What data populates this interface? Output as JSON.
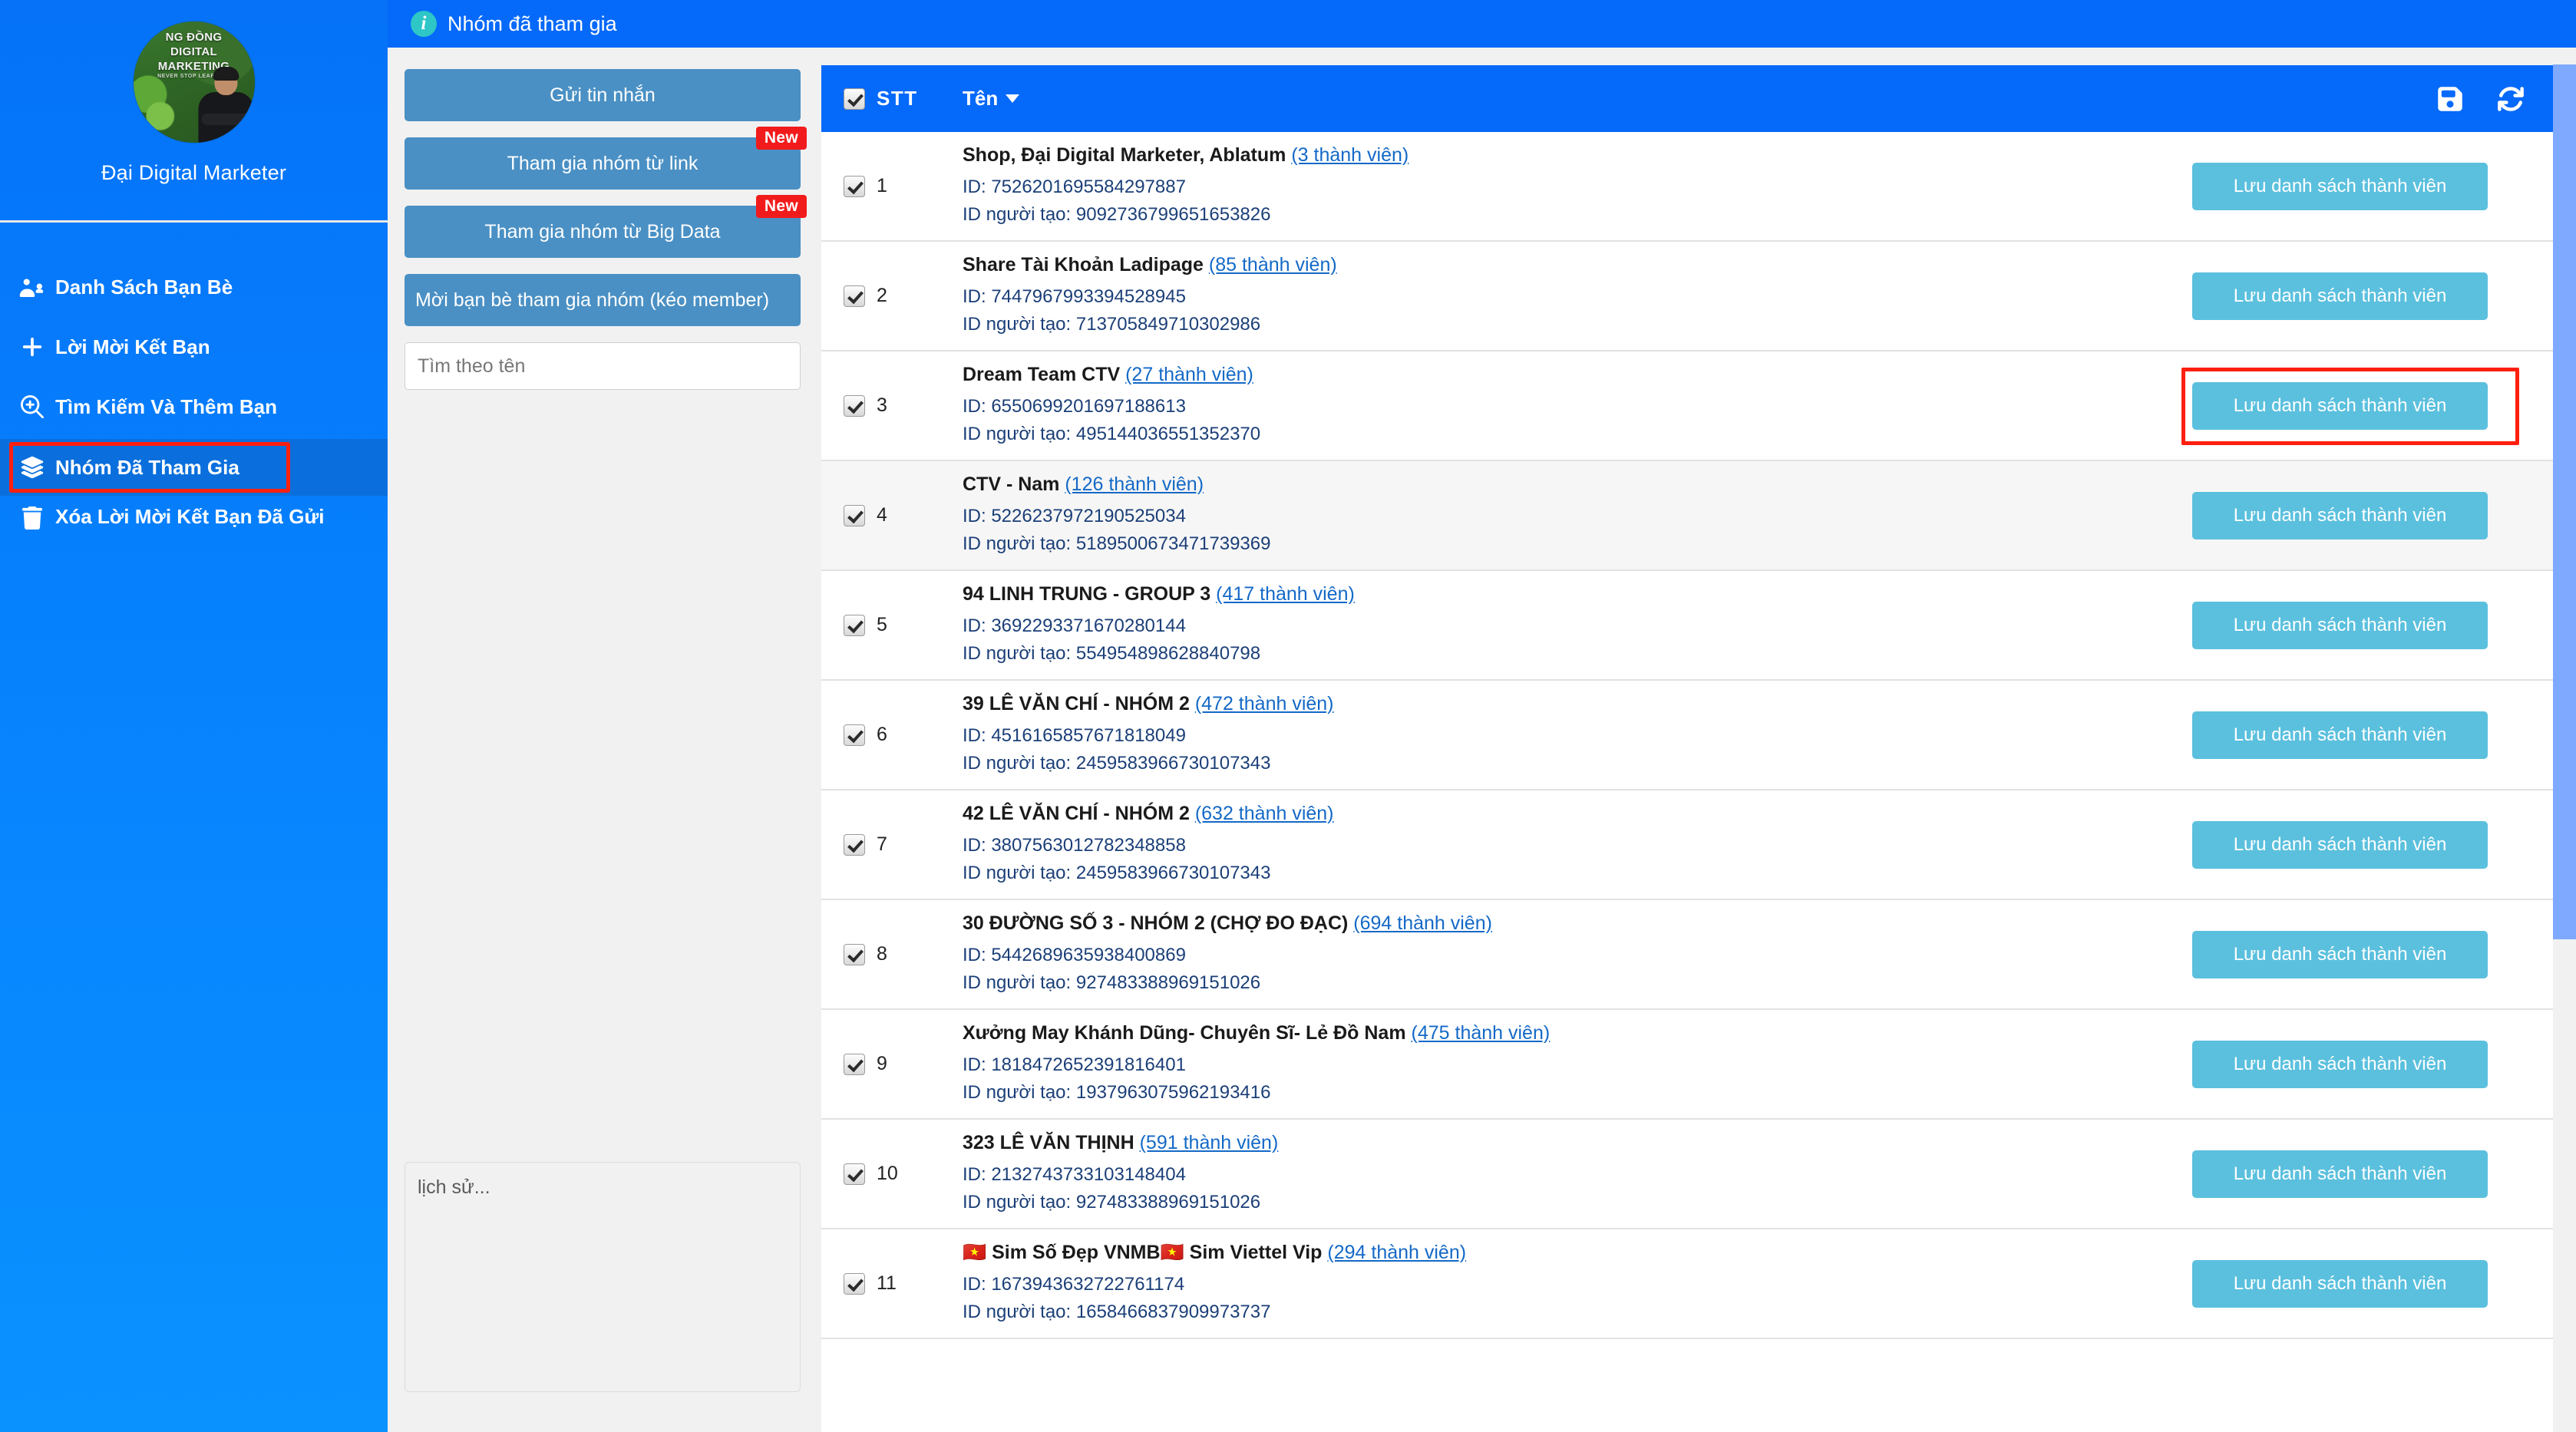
{
  "sidebar": {
    "profile": {
      "name": "Đại Digital Marketer",
      "avatar_line1": "NG ĐỒNG",
      "avatar_line2": "DIGITAL MARKETING",
      "avatar_line3": "NEVER STOP LEARNING"
    },
    "items": [
      {
        "label": "Danh Sách Bạn Bè",
        "icon": "users-icon",
        "active": false
      },
      {
        "label": "Lời Mời Kết Bạn",
        "icon": "plus-icon",
        "active": false
      },
      {
        "label": "Tìm Kiếm Và Thêm Bạn",
        "icon": "search-plus-icon",
        "active": false
      },
      {
        "label": "Nhóm Đã Tham Gia",
        "icon": "layers-icon",
        "active": true
      },
      {
        "label": "Xóa Lời Mời Kết Bạn Đã Gửi",
        "icon": "trash-icon",
        "active": false
      }
    ]
  },
  "topbar": {
    "title": "Nhóm đã tham gia",
    "icon": "info-icon"
  },
  "midpanel": {
    "buttons": [
      {
        "label": "Gửi tin nhắn",
        "badge": ""
      },
      {
        "label": "Tham gia nhóm từ link",
        "badge": "New"
      },
      {
        "label": "Tham gia nhóm từ Big Data",
        "badge": "New"
      },
      {
        "label": "Mời bạn bè tham gia nhóm (kéo member)",
        "badge": ""
      }
    ],
    "search_placeholder": "Tìm theo tên",
    "search_value": "",
    "history_placeholder": "lịch sử...",
    "history_value": ""
  },
  "table": {
    "header": {
      "stt": "STT",
      "ten": "Tên",
      "sort_icon": "chevron-down-icon",
      "save_icon": "floppy-disk-icon",
      "refresh_icon": "refresh-icon",
      "select_all_checked": true
    },
    "save_button_label": "Lưu danh sách thành viên",
    "id_label": "ID:",
    "creator_label": "ID người tạo:",
    "rows": [
      {
        "stt": "1",
        "name": "Shop, Đại Digital Marketer, Ablatum",
        "members": "(3 thành viên)",
        "id": "ID: 7526201695584297887",
        "creator": "ID người tạo: 9092736799651653826",
        "checked": true,
        "highlight": false,
        "flag_prefix": "",
        "flag_mid": ""
      },
      {
        "stt": "2",
        "name": "Share Tài Khoản Ladipage",
        "members": "(85 thành viên)",
        "id": "ID: 7447967993394528945",
        "creator": "ID người tạo: 713705849710302986",
        "checked": true,
        "highlight": false,
        "flag_prefix": "",
        "flag_mid": ""
      },
      {
        "stt": "3",
        "name": "Dream Team CTV",
        "members": "(27 thành viên)",
        "id": "ID: 6550699201697188613",
        "creator": "ID người tạo: 495144036551352370",
        "checked": true,
        "highlight": true,
        "flag_prefix": "",
        "flag_mid": ""
      },
      {
        "stt": "4",
        "name": "CTV - Nam",
        "members": "(126 thành viên)",
        "id": "ID: 5226237972190525034",
        "creator": "ID người tạo: 5189500673471739369",
        "checked": true,
        "highlight": false,
        "flag_prefix": "",
        "flag_mid": ""
      },
      {
        "stt": "5",
        "name": "94 LINH TRUNG - GROUP 3",
        "members": "(417 thành viên)",
        "id": "ID: 3692293371670280144",
        "creator": "ID người tạo: 554954898628840798",
        "checked": true,
        "highlight": false,
        "flag_prefix": "",
        "flag_mid": ""
      },
      {
        "stt": "6",
        "name": "39 LÊ VĂN CHÍ - NHÓM 2",
        "members": "(472 thành viên)",
        "id": "ID: 4516165857671818049",
        "creator": "ID người tạo: 2459583966730107343",
        "checked": true,
        "highlight": false,
        "flag_prefix": "",
        "flag_mid": ""
      },
      {
        "stt": "7",
        "name": "42 LÊ VĂN CHÍ - NHÓM 2",
        "members": "(632 thành viên)",
        "id": "ID: 3807563012782348858",
        "creator": "ID người tạo: 2459583966730107343",
        "checked": true,
        "highlight": false,
        "flag_prefix": "",
        "flag_mid": ""
      },
      {
        "stt": "8",
        "name": "30 ĐƯỜNG SỐ 3 - NHÓM 2 (CHỢ ĐO ĐẠC)",
        "members": "(694 thành viên)",
        "id": "ID: 5442689635938400869",
        "creator": "ID người tạo: 927483388969151026",
        "checked": true,
        "highlight": false,
        "flag_prefix": "",
        "flag_mid": ""
      },
      {
        "stt": "9",
        "name": "Xưởng May Khánh Dũng- Chuyên Sĩ- Lẻ Đồ Nam",
        "members": "(475 thành viên)",
        "id": "ID: 1818472652391816401",
        "creator": "ID người tạo: 1937963075962193416",
        "checked": true,
        "highlight": false,
        "flag_prefix": "",
        "flag_mid": ""
      },
      {
        "stt": "10",
        "name": "323 LÊ VĂN THỊNH",
        "members": "(591 thành viên)",
        "id": "ID: 2132743733103148404",
        "creator": "ID người tạo: 927483388969151026",
        "checked": true,
        "highlight": false,
        "flag_prefix": "",
        "flag_mid": ""
      },
      {
        "stt": "11",
        "name": "Sim Số Đẹp VNMB",
        "name2": "Sim Viettel Vip",
        "members": "(294 thành viên)",
        "id": "ID: 1673943632722761174",
        "creator": "ID người tạo: 1658466837909973737",
        "checked": true,
        "highlight": false,
        "flag_prefix": "🇻🇳",
        "flag_mid": "🇻🇳"
      }
    ]
  },
  "colors": {
    "brand_blue": "#0569fa",
    "sidebar_active": "#0a6fdc",
    "highlight_red": "#ff1f0f",
    "save_btn": "#5bc0de",
    "panel_btn": "#4a90c4",
    "badge_red": "#f21b1b",
    "link_blue": "#1469c7"
  }
}
